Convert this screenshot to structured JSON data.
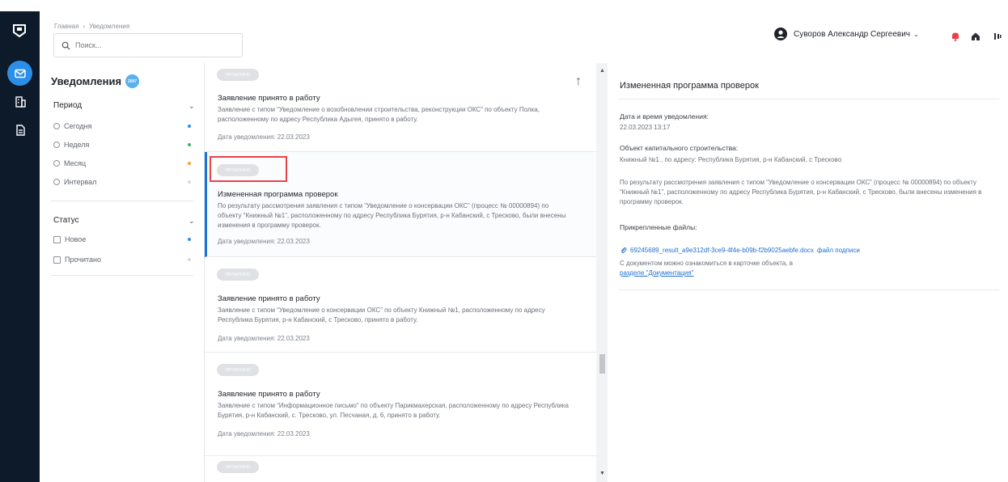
{
  "breadcrumb": {
    "home": "Главная",
    "separator": "›",
    "current": "Уведомления"
  },
  "search": {
    "placeholder": "Поиск..."
  },
  "user": {
    "name": "Суворов Александр Сергеевич",
    "chevron": "⌄"
  },
  "sidebar": {
    "title": "Уведомления",
    "badge": "2007"
  },
  "filters": {
    "period": {
      "label": "Период",
      "options": [
        "Сегодня",
        "Неделя",
        "Месяц",
        "Интервал"
      ],
      "dot_colors": [
        "#2b8fe8",
        "#3cb371",
        "#f5a623",
        "#d5d8dc"
      ]
    },
    "status": {
      "label": "Статус",
      "options": [
        "Новое",
        "Прочитано"
      ],
      "dot_colors": [
        "#2b8fe8",
        "#d5d8dc"
      ]
    }
  },
  "list": {
    "items": [
      {
        "chip": "ПРОЧИТАНО",
        "title": "Заявление принято в работу",
        "text": "Заявление с типом “Уведомление о возобновлении строительства, реконструкции ОКС” по объекту Полка, расположенному по адресу Республика Адыгея, принято в работу.",
        "date": "Дата уведомления: 22.03.2023"
      },
      {
        "chip": "ПРОЧИТАНО",
        "title": "Измененная программа проверок",
        "text": "По результату рассмотрения заявления с типом “Уведомление о консервации ОКС” (процесс № 00000894) по объекту “Книжный №1”, расположенному по адресу Республика Бурятия, р-н Кабанский, с Тресково, были внесены изменения в программу проверок.",
        "date": "Дата уведомления: 22.03.2023"
      },
      {
        "chip": "ПРОЧИТАНО",
        "title": "Заявление принято в работу",
        "text": "Заявление с типом “Уведомление о консервации ОКС” по объекту Книжный №1, расположенному по адресу Республика Бурятия, р-н Кабанский, с Тресково, принято в работу.",
        "date": "Дата уведомления: 22.03.2023"
      },
      {
        "chip": "ПРОЧИТАНО",
        "title": "Заявление принято в работу",
        "text": "Заявление с типом “Информационное письмо” по объекту Парикмахерская, расположенному по адресу Республика Бурятия, р-н Кабанский, с. Тресково, ул. Песчаная, д. 6, принято в работу.",
        "date": "Дата уведомления: 22.03.2023"
      },
      {
        "chip": "ПРОЧИТАНО"
      }
    ]
  },
  "detail": {
    "title": "Измененная программа проверок",
    "datetime_label": "Дата и время уведомления:",
    "datetime_value": "22.03.2023 13:17",
    "object_label": "Объект капитального строительства:",
    "object_value": "Книжный №1 , по адресу: Республика Бурятия, р-н Кабанский, с Тресково",
    "body": "По результату рассмотрения заявления с типом “Уведомление о консервации ОКС” (процесс № 00000894) по объекту “Книжный №1”, расположенному по адресу Республика Бурятия, р-н Кабанский, с Тресково, были внесены изменения в программу проверок.",
    "files_label": "Прикрепленные файлы:",
    "file_name": "69245689_result_a9e312df-3ce9-4f4e-b09b-f2b9025aebfe.docx",
    "signature_link": "файл подписи",
    "doc_note": "С документом можно ознакомиться в карточке объекта, в",
    "doc_link": "разделе \"Документация\""
  },
  "colors": {
    "rail": "#0d1a2a",
    "accent": "#2b8fe8",
    "highlight": "#e8434a",
    "link": "#1e6fd0"
  }
}
